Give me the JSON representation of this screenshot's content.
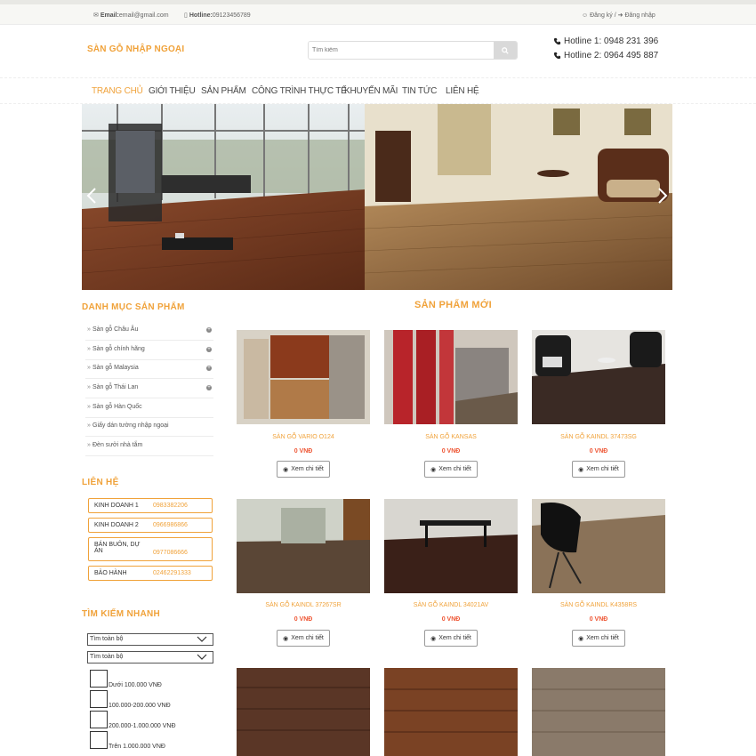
{
  "topbar": {
    "email_label": "Email:",
    "email_value": "email@gmail.com",
    "hotline_label": "Hotline:",
    "hotline_value": "09123456789",
    "register": "Đăng ký",
    "separator": "/",
    "login": "Đăng nhập"
  },
  "header": {
    "logo": "SÀN GỖ NHẬP NGOẠI",
    "search_placeholder": "Tìm kiếm",
    "hotline1": "Hotline 1: 0948 231 396",
    "hotline2": "Hotline 2: 0964 495 887"
  },
  "nav": [
    "TRANG CHỦ",
    "GIỚI THIỆU",
    "SẢN PHẨM",
    "CÔNG TRÌNH THỰC TẾ",
    "KHUYẾN MÃI",
    "TIN TỨC",
    "LIÊN HỆ"
  ],
  "sidebar": {
    "categories_title": "DANH MỤC SẢN PHẨM",
    "categories": [
      {
        "label": "Sàn gỗ Châu Âu",
        "expandable": true
      },
      {
        "label": "Sàn gỗ chính hãng",
        "expandable": true
      },
      {
        "label": "Sàn gỗ Malaysia",
        "expandable": true
      },
      {
        "label": "Sàn gỗ Thái Lan",
        "expandable": true
      },
      {
        "label": "Sàn gỗ Hàn Quốc",
        "expandable": false
      },
      {
        "label": "Giấy dán tường nhập ngoại",
        "expandable": false
      },
      {
        "label": "Đèn sưởi nhà tắm",
        "expandable": false
      }
    ],
    "contact_title": "LIÊN HỆ",
    "contacts": [
      {
        "name": "KINH DOANH 1",
        "phone": "0983382206"
      },
      {
        "name": "KINH DOANH 2",
        "phone": "0966986866"
      },
      {
        "name": "BÁN BUÔN, DỰ ÁN",
        "phone": "0977086666"
      },
      {
        "name": "BẢO HÀNH",
        "phone": "02462291333"
      }
    ],
    "quick_search_title": "TÌM KIẾM NHANH",
    "select1": "Tìm toàn bộ",
    "select2": "Tìm toàn bộ",
    "price_filters": [
      "Dưới 100.000 VNĐ",
      "100.000-200.000 VNĐ",
      "200.000-1.000.000 VNĐ",
      "Trên 1.000.000 VNĐ"
    ]
  },
  "products": {
    "title": "SẢN PHẨM MỚI",
    "button_label": "Xem chi tiết",
    "items": [
      {
        "name": "SÀN GỖ VARIO O124",
        "price": "0 VNĐ"
      },
      {
        "name": "SÀN GỖ KANSAS",
        "price": "0 VNĐ"
      },
      {
        "name": "SÀN GỖ KAINDL 37473SG",
        "price": "0 VNĐ"
      },
      {
        "name": "SÀN GỖ KAINDL 37267SR",
        "price": "0 VNĐ"
      },
      {
        "name": "SÀN GỖ KAINDL 34021AV",
        "price": "0 VNĐ"
      },
      {
        "name": "SÀN GỖ KAINDL K4358RS",
        "price": "0 VNĐ"
      }
    ]
  },
  "colors": {
    "accent": "#f0a23a",
    "price": "#ee5533"
  }
}
